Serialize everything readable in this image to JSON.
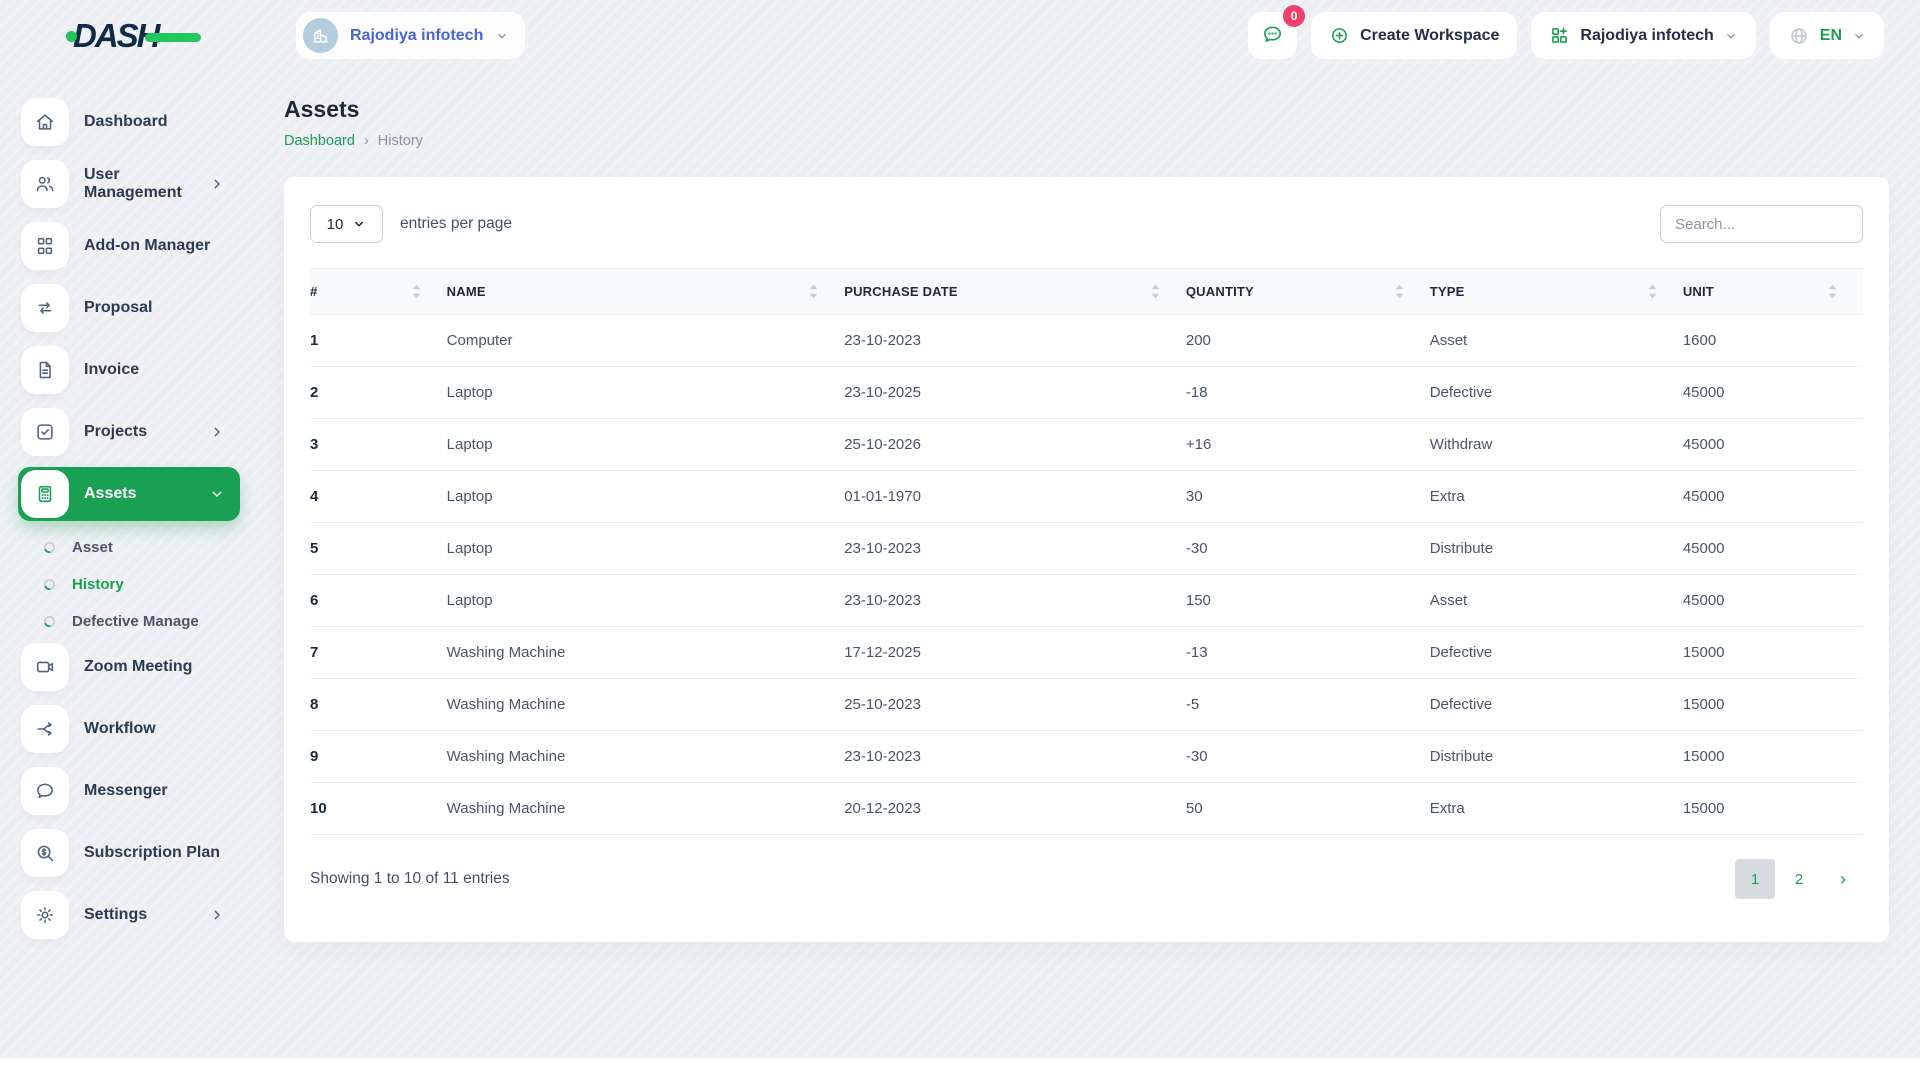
{
  "brand": {
    "logo_text": "DASH"
  },
  "topbar": {
    "workspace_pill": {
      "label": "Rajodiya infotech",
      "icon": "building"
    },
    "messages": {
      "badge": "0"
    },
    "create_workspace_label": "Create Workspace",
    "company_dropdown_label": "Rajodiya infotech",
    "language": {
      "code": "EN"
    }
  },
  "sidebar": {
    "items": [
      {
        "label": "Dashboard",
        "icon": "home"
      },
      {
        "label": "User Management",
        "icon": "users",
        "chevron": true
      },
      {
        "label": "Add-on Manager",
        "icon": "grid"
      },
      {
        "label": "Proposal",
        "icon": "swap"
      },
      {
        "label": "Invoice",
        "icon": "file"
      },
      {
        "label": "Projects",
        "icon": "check-square",
        "chevron": true
      },
      {
        "label": "Assets",
        "icon": "calculator",
        "active": true,
        "expanded": true
      },
      {
        "label": "Zoom Meeting",
        "icon": "video"
      },
      {
        "label": "Workflow",
        "icon": "share"
      },
      {
        "label": "Messenger",
        "icon": "chat"
      },
      {
        "label": "Subscription Plan",
        "icon": "search-dollar"
      },
      {
        "label": "Settings",
        "icon": "gear",
        "chevron": true
      }
    ],
    "assets_subitems": [
      {
        "label": "Asset",
        "active": false
      },
      {
        "label": "History",
        "active": true
      },
      {
        "label": "Defective Manage",
        "active": false
      }
    ]
  },
  "page": {
    "title": "Assets",
    "breadcrumb": {
      "root": "Dashboard",
      "separator": "›",
      "current": "History"
    }
  },
  "table_controls": {
    "page_size": "10",
    "entries_label": "entries per page",
    "search_placeholder": "Search..."
  },
  "table": {
    "columns": [
      "#",
      "NAME",
      "PURCHASE DATE",
      "QUANTITY",
      "TYPE",
      "UNIT"
    ],
    "rows": [
      [
        "1",
        "Computer",
        "23-10-2023",
        "200",
        "Asset",
        "1600"
      ],
      [
        "2",
        "Laptop",
        "23-10-2025",
        "-18",
        "Defective",
        "45000"
      ],
      [
        "3",
        "Laptop",
        "25-10-2026",
        "+16",
        "Withdraw",
        "45000"
      ],
      [
        "4",
        "Laptop",
        "01-01-1970",
        "30",
        "Extra",
        "45000"
      ],
      [
        "5",
        "Laptop",
        "23-10-2023",
        "-30",
        "Distribute",
        "45000"
      ],
      [
        "6",
        "Laptop",
        "23-10-2023",
        "150",
        "Asset",
        "45000"
      ],
      [
        "7",
        "Washing Machine",
        "17-12-2025",
        "-13",
        "Defective",
        "15000"
      ],
      [
        "8",
        "Washing Machine",
        "25-10-2023",
        "-5",
        "Defective",
        "15000"
      ],
      [
        "9",
        "Washing Machine",
        "23-10-2023",
        "-30",
        "Distribute",
        "15000"
      ],
      [
        "10",
        "Washing Machine",
        "20-12-2023",
        "50",
        "Extra",
        "15000"
      ]
    ]
  },
  "footer": {
    "showing_text": "Showing 1 to 10 of 11 entries",
    "pagination": {
      "pages": [
        "1",
        "2"
      ],
      "active": "1",
      "next": "›"
    }
  },
  "colors": {
    "primary_green": "#1aa053",
    "logo_navy": "#0f2b46",
    "logo_green": "#22c55e",
    "badge_pink": "#f0416c",
    "workspace_label_blue": "#4a63d8",
    "active_page_bg": "#d7dbe0",
    "page_background": "#edeff3"
  }
}
